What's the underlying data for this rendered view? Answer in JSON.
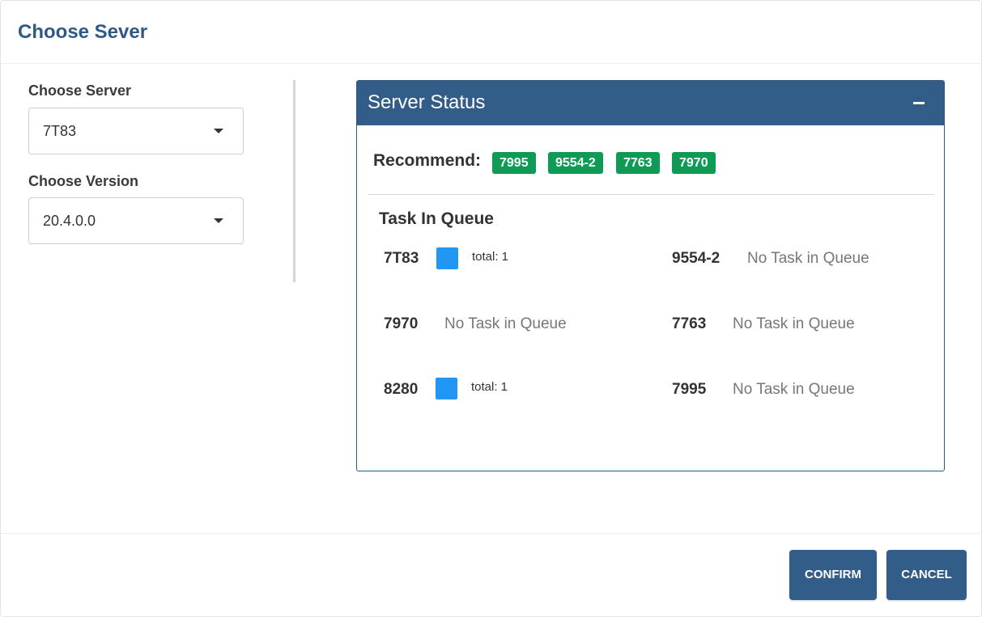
{
  "dialog": {
    "title": "Choose Sever"
  },
  "form": {
    "server_label": "Choose Server",
    "server_value": "7T83",
    "version_label": "Choose Version",
    "version_value": "20.4.0.0"
  },
  "server_status": {
    "title": "Server Status",
    "collapse_icon": "minus-icon",
    "recommend_label": "Recommend:",
    "recommended": [
      "7995",
      "9554-2",
      "7763",
      "7970"
    ],
    "queue_title": "Task In Queue",
    "queue": [
      {
        "server": "7T83",
        "has_tasks": true,
        "total": "total: 1"
      },
      {
        "server": "9554-2",
        "has_tasks": false,
        "status": "No Task in Queue"
      },
      {
        "server": "7970",
        "has_tasks": false,
        "status": "No Task in Queue"
      },
      {
        "server": "7763",
        "has_tasks": false,
        "status": "No Task in Queue"
      },
      {
        "server": "8280",
        "has_tasks": true,
        "total": "total: 1"
      },
      {
        "server": "7995",
        "has_tasks": false,
        "status": "No Task in Queue"
      }
    ]
  },
  "footer": {
    "confirm_label": "CONFIRM",
    "cancel_label": "CANCEL"
  },
  "colors": {
    "primary": "#325d89",
    "recommend_badge": "#0d9b55",
    "task_square": "#2196f3",
    "title": "#2f5a85"
  }
}
